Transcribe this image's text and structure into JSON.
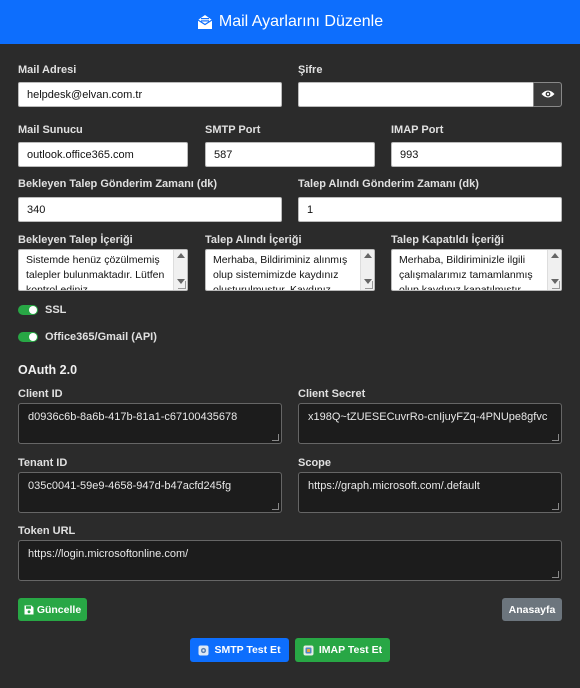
{
  "header": {
    "title": "Mail Ayarlarını Düzenle",
    "icon": "envelope-open-icon"
  },
  "labels": {
    "mail_address": "Mail Adresi",
    "password": "Şifre",
    "mail_server": "Mail Sunucu",
    "smtp_port": "SMTP Port",
    "imap_port": "IMAP Port",
    "pending_time": "Bekleyen Talep Gönderim Zamanı (dk)",
    "received_time": "Talep Alındı Gönderim Zamanı (dk)",
    "pending_content": "Bekleyen Talep İçeriği",
    "received_content": "Talep Alındı İçeriği",
    "closed_content": "Talep Kapatıldı İçeriği",
    "oauth_heading": "OAuth 2.0",
    "client_id": "Client ID",
    "client_secret": "Client Secret",
    "tenant_id": "Tenant ID",
    "scope": "Scope",
    "token_url": "Token URL"
  },
  "values": {
    "mail_address": "helpdesk@elvan.com.tr",
    "password": "",
    "mail_server": "outlook.office365.com",
    "smtp_port": "587",
    "imap_port": "993",
    "pending_time": "340",
    "received_time": "1",
    "pending_content": "Sistemde henüz çözülmemiş talepler bulunmaktadır. Lütfen kontrol ediniz.",
    "received_content": "Merhaba, Bildiriminiz alınmış olup sistemimizde kaydınız oluşturulmuştur. Kaydınız",
    "closed_content": "Merhaba,  Bildiriminizle ilgili çalışmalarımız tamamlanmış olup kaydınız kapatılmıştır.",
    "client_id": "d0936c6b-8a6b-417b-81a1-c67100435678",
    "client_secret": "x198Q~tZUESECuvrRo-cnIjuyFZq-4PNUpe8gfvc",
    "tenant_id": "035c0041-59e9-4658-947d-b47acfd245fg",
    "scope": "https://graph.microsoft.com/.default",
    "token_url": "https://login.microsoftonline.com/"
  },
  "switches": {
    "ssl": {
      "label": "SSL",
      "on": true
    },
    "office365": {
      "label": "Office365/Gmail (API)",
      "on": true
    }
  },
  "buttons": {
    "update": "Güncelle",
    "home": "Anasayfa",
    "smtp_test": "SMTP Test Et",
    "imap_test": "IMAP Test Et"
  },
  "colors": {
    "primary": "#0d6efd",
    "success": "#28a745",
    "secondary": "#6c757d",
    "background": "#2b2b2b"
  }
}
